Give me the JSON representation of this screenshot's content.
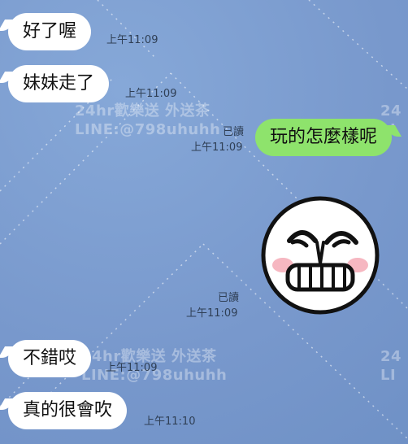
{
  "messages": [
    {
      "direction": "incoming",
      "text": "好了喔",
      "time": "上午11:09"
    },
    {
      "direction": "incoming",
      "text": "妹妹走了",
      "time": "上午11:09"
    },
    {
      "direction": "outgoing",
      "text": "玩的怎麼樣呢",
      "read": "已讀",
      "time": "上午11:09"
    },
    {
      "direction": "outgoing",
      "type": "sticker",
      "sticker": "grinning-moon-face-sticker",
      "read": "已讀",
      "time": "上午11:09"
    },
    {
      "direction": "incoming",
      "text": "不錯哎",
      "time": "上午11:09"
    },
    {
      "direction": "incoming",
      "text": "真的很會吹",
      "time": "上午11:10"
    }
  ],
  "watermark": {
    "line1": "24hr歡樂送 外送茶",
    "line2": "LINE:@798uhuhh",
    "edge_fragment_1": "24",
    "edge_fragment_2": "LI"
  },
  "colors": {
    "background": "#7e9fd0",
    "incoming_bubble": "#ffffff",
    "outgoing_bubble": "#8ee36c",
    "timestamp": "#2f3f55"
  }
}
